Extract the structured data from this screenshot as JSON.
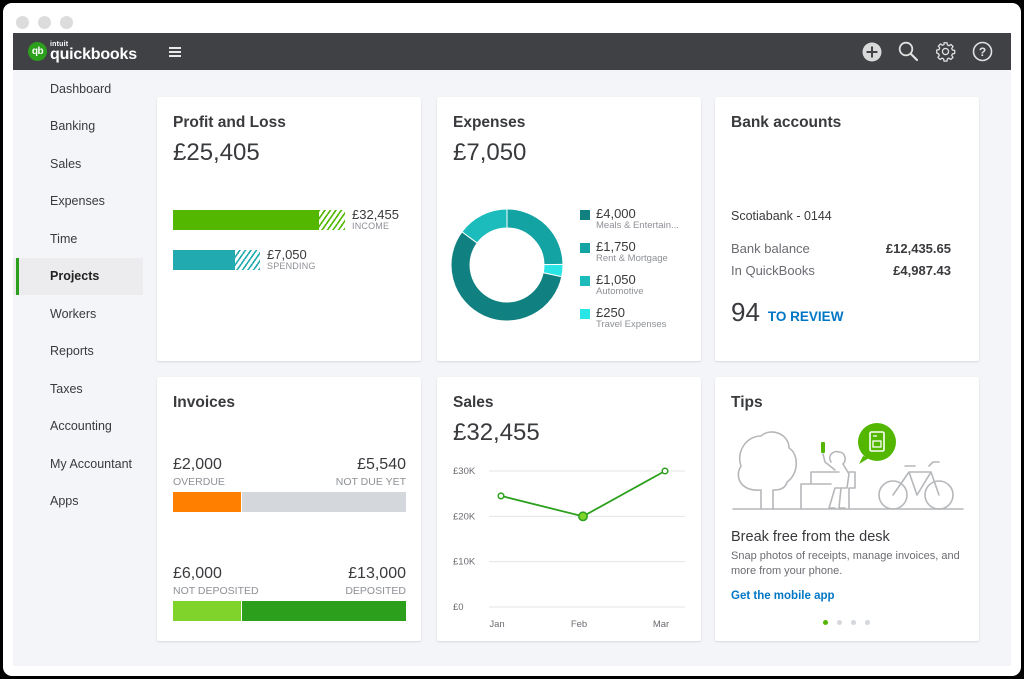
{
  "window": {
    "traffic_lights": [
      "close",
      "minimize",
      "maximize"
    ]
  },
  "topbar": {
    "logo_badge": "qb",
    "logo_brand": "intuit",
    "logo_name": "quickbooks",
    "icons": [
      "plus-circle-icon",
      "search-icon",
      "gear-icon",
      "help-icon"
    ]
  },
  "sidebar": {
    "items": [
      {
        "label": "Dashboard",
        "active": false
      },
      {
        "label": "Banking",
        "active": false
      },
      {
        "label": "Sales",
        "active": false
      },
      {
        "label": "Expenses",
        "active": false
      },
      {
        "label": "Time",
        "active": false
      },
      {
        "label": "Projects",
        "active": true
      },
      {
        "label": "Workers",
        "active": false
      },
      {
        "label": "Reports",
        "active": false
      },
      {
        "label": "Taxes",
        "active": false
      },
      {
        "label": "Accounting",
        "active": false
      },
      {
        "label": "My Accountant",
        "active": false
      },
      {
        "label": "Apps",
        "active": false
      }
    ]
  },
  "profit_loss": {
    "title": "Profit and Loss",
    "amount": "£25,405",
    "income": {
      "value": "£32,455",
      "caption": "INCOME",
      "color": "#53b700",
      "fill_fraction": 0.82
    },
    "spending": {
      "value": "£7,050",
      "caption": "SPENDING",
      "color": "#21abb0",
      "fill_fraction": 0.3
    }
  },
  "expenses": {
    "title": "Expenses",
    "amount": "£7,050",
    "items": [
      {
        "value": "£4,000",
        "name": "Meals & Entertain...",
        "color": "#108080"
      },
      {
        "value": "£1,750",
        "name": "Rent & Mortgage",
        "color": "#14a3a3"
      },
      {
        "value": "£1,050",
        "name": "Automotive",
        "color": "#1cbcbc"
      },
      {
        "value": "£250",
        "name": "Travel Expenses",
        "color": "#2ae5e5"
      }
    ]
  },
  "bank": {
    "title": "Bank accounts",
    "account_name": "Scotiabank - 0144",
    "rows": [
      {
        "label": "Bank balance",
        "amount": "£12,435.65"
      },
      {
        "label": "In QuickBooks",
        "amount": "£4,987.43"
      }
    ],
    "review_count": "94",
    "review_label": "TO REVIEW"
  },
  "invoices": {
    "title": "Invoices",
    "unpaid": {
      "left_value": "£2,000",
      "left_caption": "OVERDUE",
      "right_value": "£5,540",
      "right_caption": "NOT DUE YET",
      "left_fraction": 0.29,
      "left_color": "#ff8000",
      "right_color": "#d4d7dc"
    },
    "paid": {
      "left_value": "£6,000",
      "left_caption": "NOT DEPOSITED",
      "right_value": "£13,000",
      "right_caption": "DEPOSITED",
      "left_fraction": 0.29,
      "left_color": "#7fd32a",
      "right_color": "#2ca01c"
    }
  },
  "sales": {
    "title": "Sales",
    "amount": "£32,455"
  },
  "tips": {
    "title": "Tips",
    "headline": "Break free from the desk",
    "body": "Snap photos of receipts, manage invoices, and more from your phone.",
    "link": "Get the mobile app",
    "pages": 4,
    "current_page": 1
  },
  "chart_data": [
    {
      "type": "pie",
      "title": "Expenses",
      "categories": [
        "Meals & Entertainment",
        "Rent & Mortgage",
        "Automotive",
        "Travel Expenses"
      ],
      "values": [
        4000,
        1750,
        1050,
        250
      ],
      "colors": [
        "#108080",
        "#14a3a3",
        "#1cbcbc",
        "#2ae5e5"
      ],
      "donut": true,
      "legend": "right"
    },
    {
      "type": "line",
      "title": "Sales",
      "categories": [
        "Jan",
        "Feb",
        "Mar"
      ],
      "series": [
        {
          "name": "Sales",
          "values": [
            24500,
            20000,
            30000
          ],
          "color": "#2ca01c"
        }
      ],
      "yticks": [
        0,
        10000,
        20000,
        30000
      ],
      "ytick_labels": [
        "£0",
        "£10K",
        "£20K",
        "£30K"
      ],
      "ylim": [
        0,
        30000
      ],
      "highlight_index": 1,
      "grid": true,
      "xlabel": "",
      "ylabel": ""
    }
  ]
}
